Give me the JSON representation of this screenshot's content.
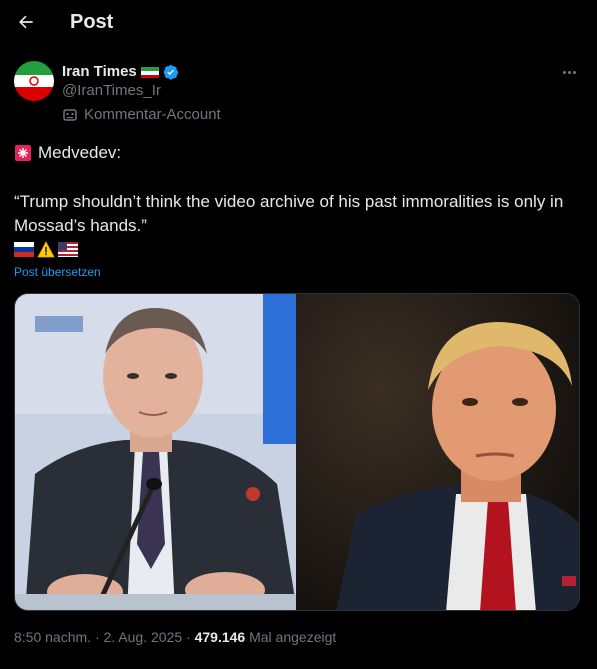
{
  "header": {
    "title": "Post"
  },
  "author": {
    "name": "Iran Times",
    "handle": "@IranTimes_Ir",
    "account_label": "Kommentar-Account"
  },
  "post": {
    "line1": "Medvedev:",
    "quote": "“Trump shouldn’t think the video archive of his past immoralities is only in Mossad’s hands.”",
    "translate_label": "Post übersetzen"
  },
  "meta": {
    "time": "8:50 nachm.",
    "sep1": " · ",
    "date": "2. Aug. 2025",
    "sep2": " · ",
    "views": "479.146",
    "views_label": " Mal angezeigt"
  },
  "icons": {
    "back": "arrow-left-icon",
    "verified": "verified-badge-icon",
    "more": "more-horizontal-icon",
    "comment_account": "robot-mask-icon",
    "siren": "police-siren-icon"
  },
  "colors": {
    "background": "#000000",
    "text": "#e7e9ea",
    "muted": "#71767b",
    "accent": "#1d9bf0"
  }
}
